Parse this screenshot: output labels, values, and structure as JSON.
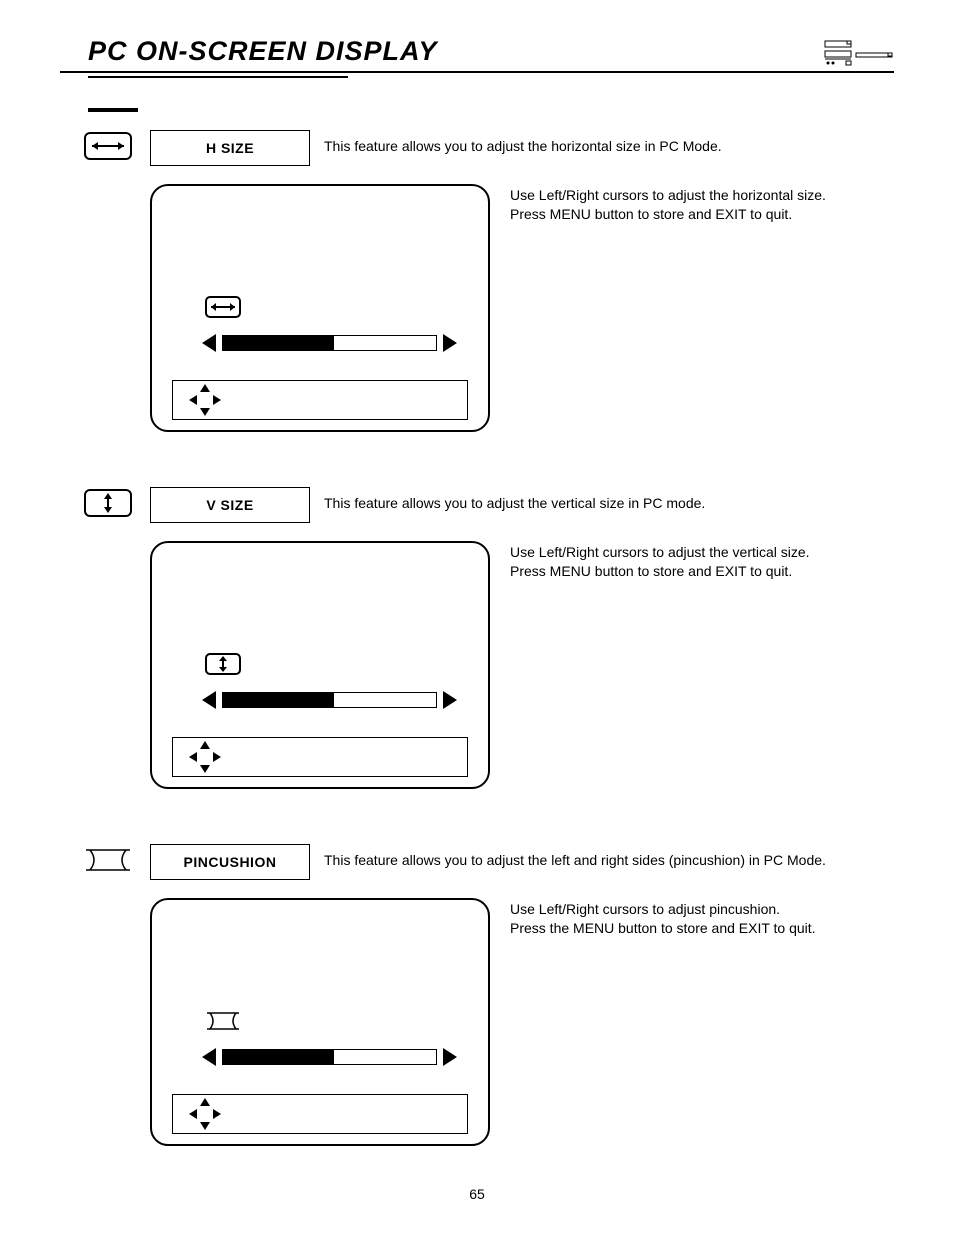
{
  "page_title": "PC ON-SCREEN DISPLAY",
  "page_number": "65",
  "sections": [
    {
      "label": "H SIZE",
      "intro": "This feature allows you to adjust the horizontal size in PC Mode.",
      "detail_line1": "Use Left/Right cursors to adjust the horizontal size.",
      "detail_line2": "Press MENU button to store and EXIT to quit.",
      "slider_fill_pct": 52,
      "icon": "h-size"
    },
    {
      "label": "V SIZE",
      "intro": "This feature allows you to adjust the vertical size in PC mode.",
      "detail_line1": "Use Left/Right cursors to adjust the vertical size.",
      "detail_line2": "Press MENU button to store and EXIT to quit.",
      "slider_fill_pct": 52,
      "icon": "v-size"
    },
    {
      "label": "PINCUSHION",
      "intro": "This feature allows you to adjust the left and right sides (pincushion) in PC Mode.",
      "detail_line1": "Use Left/Right cursors to adjust pincushion.",
      "detail_line2": "Press the MENU button to store and EXIT to quit.",
      "slider_fill_pct": 52,
      "icon": "pincushion"
    }
  ]
}
